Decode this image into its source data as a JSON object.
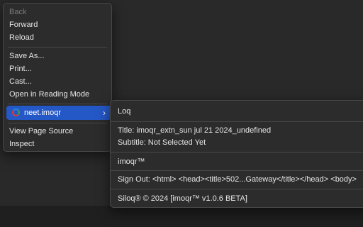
{
  "context_menu": {
    "items": [
      {
        "label": "Back",
        "enabled": false
      },
      {
        "label": "Forward",
        "enabled": true
      },
      {
        "label": "Reload",
        "enabled": true
      },
      {
        "label": "Save As...",
        "enabled": true
      },
      {
        "label": "Print...",
        "enabled": true
      },
      {
        "label": "Cast...",
        "enabled": true
      },
      {
        "label": "Open in Reading Mode",
        "enabled": true
      },
      {
        "label": "neet.imoqr",
        "enabled": true,
        "highlighted": true,
        "has_submenu": true
      },
      {
        "label": "View Page Source",
        "enabled": true
      },
      {
        "label": "Inspect",
        "enabled": true
      }
    ],
    "highlight_color": "#2558c7"
  },
  "submenu": {
    "items": [
      {
        "label": "Loq"
      },
      {
        "label": "Title: imoqr_extn_sun jul 21 2024_undefined"
      },
      {
        "label": "Subtitle: Not Selected Yet"
      },
      {
        "label": "imoqr™"
      },
      {
        "label": "Sign Out: <html>  <head><title>502...Gateway</title></head>  <body>"
      },
      {
        "label": "Siloq® © 2024 [imoqr™ v1.0.6 BETA]"
      }
    ]
  },
  "icons": {
    "extension_icon": "extension-logo-icon",
    "submenu_arrow": "chevron-right-icon",
    "submenu_arrow_glyph": "›"
  }
}
